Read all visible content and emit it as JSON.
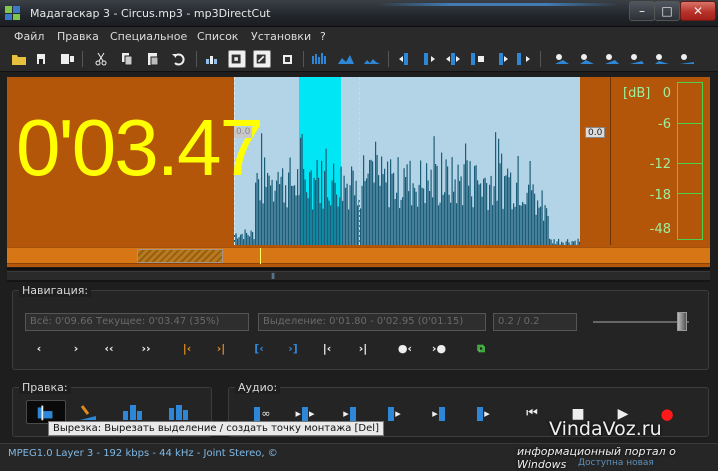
{
  "window": {
    "title": "Мадагаскар 3 - Circus.mp3 - mp3DirectCut",
    "minimize": "–",
    "maximize": "□",
    "close": "✕"
  },
  "menu": [
    "Файл",
    "Правка",
    "Специальное",
    "Список",
    "Установки",
    "?"
  ],
  "toolbar_icons": [
    "open-folder-icon",
    "save-icon",
    "save-selection-icon",
    "cut-icon",
    "copy-icon",
    "paste-icon",
    "undo-icon",
    "volume-change-icon",
    "normalize-icon",
    "fade-icon",
    "mute-icon",
    "wave-view-1-icon",
    "wave-view-2-icon",
    "wave-view-3-icon",
    "goto-cue-prev-icon",
    "goto-cue-next-icon",
    "cue-set-icon",
    "cue-remove-icon",
    "cue-move-icon",
    "fade-in-icon",
    "fade-out-icon",
    "crossfade-icon",
    "split-icon",
    "record-cue-icon"
  ],
  "waveform": {
    "time": "0'03.47",
    "left_level": "0.0",
    "right_level": "0.0",
    "db_header": "[dB]",
    "db_ticks": [
      "0",
      "-6",
      "-12",
      "-18",
      "-48"
    ]
  },
  "navigation": {
    "title": "Навигация:",
    "total": "Всё: 0'09.66  Текущее: 0'03.47  (35%)",
    "selection": "Выделение: 0'01.80 - 0'02.95 (0'01.15)",
    "ratio": "0.2 / 0.2",
    "buttons": [
      "‹",
      "›",
      "‹‹",
      "››",
      "|‹",
      "›|",
      "[‹",
      "›]",
      "|‹",
      "›|",
      "●‹",
      "›●",
      "⧉"
    ]
  },
  "edit": {
    "title": "Правка:"
  },
  "audio": {
    "title": "Аудио:",
    "loop_label": "∞"
  },
  "tooltip": "Вырезка: Вырезать выделение / создать точку монтажа   [Del]",
  "status": {
    "format": "MPEG1.0 Layer 3 - 192 kbps - 44 kHz - Joint Stereo, ©",
    "right_text": "Доступна новая"
  },
  "watermark": {
    "title": "VindaVoz.ru",
    "subtitle": "информационный портал о Windows"
  },
  "colors": {
    "wave_background": "#b4560a",
    "selection": "#b3d3e6",
    "playback_region": "#00e6f4",
    "waveform": "#1a5e7a",
    "time_text": "#ffff00",
    "meter": "#4ccf4c",
    "transport_blue": "#2e86d6",
    "record_red": "#ff1a1a"
  }
}
